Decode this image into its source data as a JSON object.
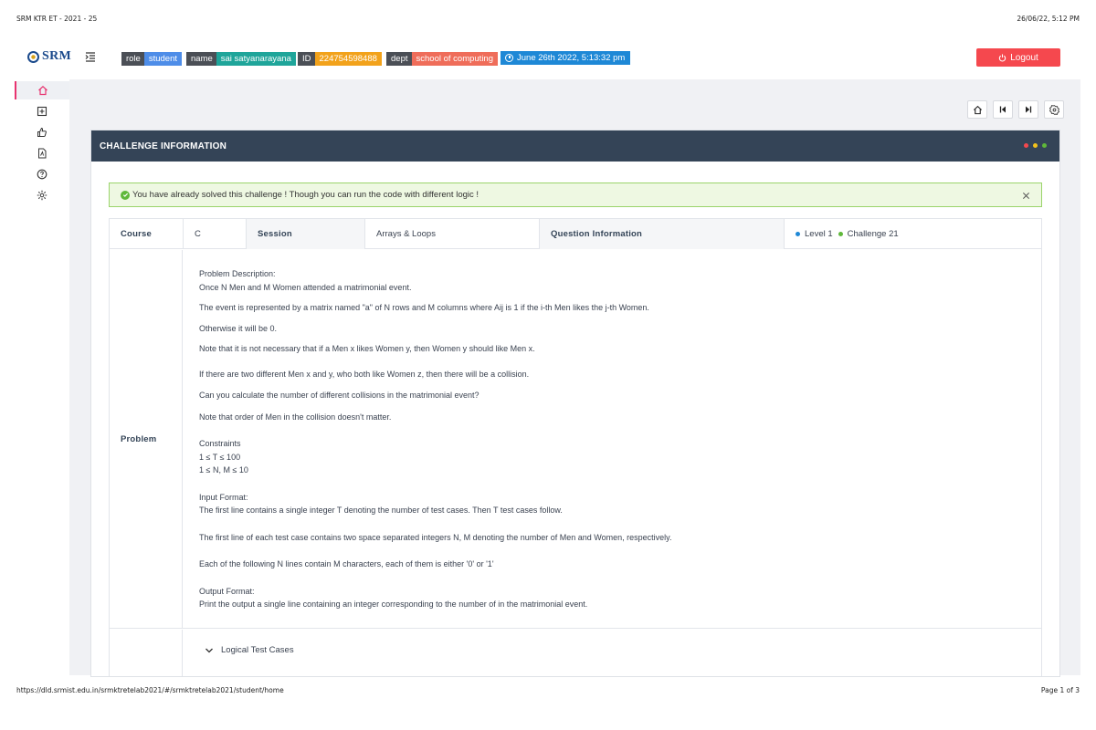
{
  "print": {
    "header_left": "SRM KTR ET - 2021 - 25",
    "header_right": "26/06/22, 5:12 PM",
    "footer_left": "https://dld.srmist.edu.in/srmktretelab2021/#/srmktretelab2021/student/home",
    "footer_right": "Page 1 of 3"
  },
  "topbar": {
    "logo_text": "SRM",
    "role_key": "role",
    "role_value": "student",
    "name_key": "name",
    "name_value": "sai satyanarayana",
    "id_key": "ID",
    "id_value": "224754598488",
    "dept_key": "dept",
    "dept_value": "school of computing",
    "datetime": "June 26th 2022, 5:13:32 pm",
    "logout_label": "Logout"
  },
  "sidebar": {
    "items": [
      {
        "icon": "home-icon",
        "active": true
      },
      {
        "icon": "plus-square-icon",
        "active": false
      },
      {
        "icon": "thumbs-up-icon",
        "active": false
      },
      {
        "icon": "pdf-file-icon",
        "active": false
      },
      {
        "icon": "help-circle-icon",
        "active": false
      },
      {
        "icon": "gear-icon",
        "active": false
      }
    ]
  },
  "nav_buttons": [
    "home-icon",
    "skip-back-icon",
    "skip-forward-icon",
    "settings-badge-icon"
  ],
  "card": {
    "title": "CHALLENGE INFORMATION",
    "dot_colors": [
      "#f5484e",
      "#f2c21b",
      "#5fb83a"
    ]
  },
  "alert": {
    "text": "You have already solved this challenge ! Though you can run the code with different logic !"
  },
  "info": {
    "course_label": "Course",
    "course_value": "C",
    "session_label": "Session",
    "session_value": "Arrays & Loops",
    "question_label": "Question Information",
    "level": "Level 1",
    "challenge": "Challenge 21",
    "level_dot_color": "#1e88d6",
    "challenge_dot_color": "#5fb83a"
  },
  "problem": {
    "label": "Problem",
    "lines": [
      "Problem Description:",
      "Once N Men and M Women attended a matrimonial event.",
      "The event is represented by a matrix named \"a\" of N rows and M columns where Aij is 1 if the i-th Men likes the j-th Women.",
      "Otherwise it will be 0.",
      "Note that it is not necessary that if a Men x likes Women y, then Women y should like Men x.",
      "If there are two different Men x and y, who both like Women z, then there will be a collision.",
      "Can you calculate the number of different collisions in the matrimonial event?",
      "Note that order of Men in the collision doesn't matter.",
      "Constraints",
      "1 ≤ T ≤ 100",
      "1 ≤ N, M ≤ 10",
      "Input Format:",
      "The first line contains a single integer T denoting the number of test cases. Then T test cases follow.",
      "The first line of each test case contains two space separated integers N, M denoting the number of Men and Women, respectively.",
      "Each of the following N lines contain M characters, each of them is either '0' or '1'",
      "Output Format:",
      "Print the output a single line containing an integer corresponding to the number of in the matrimonial event."
    ]
  },
  "logical_test_cases_label": "Logical Test Cases"
}
